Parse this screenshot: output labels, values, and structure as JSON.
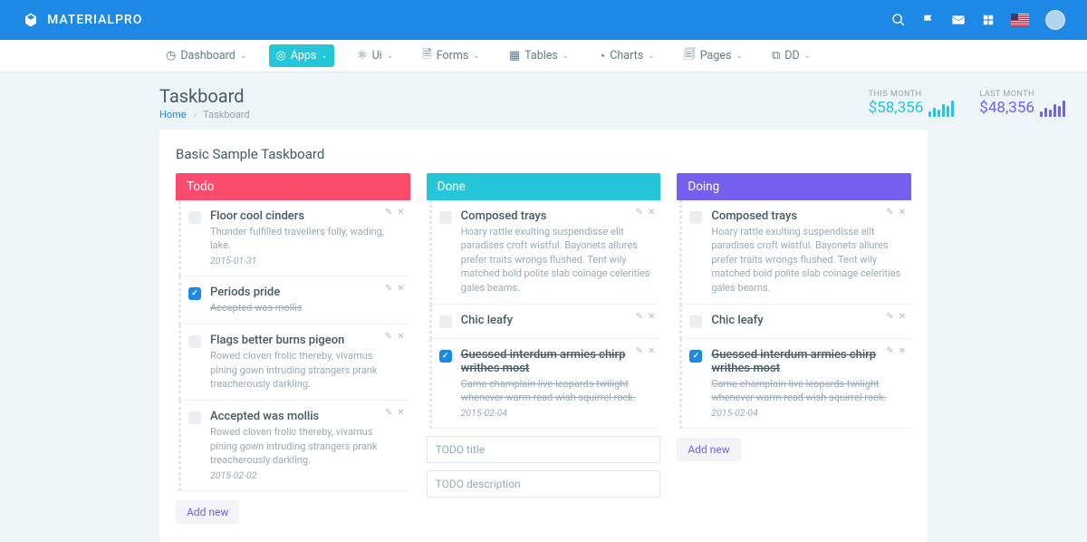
{
  "brand": "MATERIALPRO",
  "nav": [
    {
      "icon": "◷",
      "label": "Dashboard"
    },
    {
      "icon": "◎",
      "label": "Apps",
      "active": true
    },
    {
      "icon": "⚛",
      "label": "Ui"
    },
    {
      "icon": "🗎",
      "label": "Forms"
    },
    {
      "icon": "▦",
      "label": "Tables"
    },
    {
      "icon": "◔",
      "label": "Charts"
    },
    {
      "icon": "🗐",
      "label": "Pages"
    },
    {
      "icon": "⧉",
      "label": "DD"
    }
  ],
  "page": {
    "title": "Taskboard",
    "crumb_home": "Home",
    "crumb_current": "Taskboard"
  },
  "stats": {
    "this_month_label": "THIS MONTH",
    "this_month_value": "$58,356",
    "last_month_label": "LAST MONTH",
    "last_month_value": "$48,356"
  },
  "board_title": "Basic Sample Taskboard",
  "add_new_label": "Add new",
  "input_title_ph": "TODO title",
  "input_desc_ph": "TODO description",
  "columns": [
    {
      "name": "Todo",
      "color": "pink",
      "tasks": [
        {
          "title": "Floor cool cinders",
          "desc": "Thunder fulfilled travellers folly, wading, lake.",
          "date": "2015-01-31",
          "checked": false
        },
        {
          "title": "Periods pride",
          "desc": "Accepted was mollis",
          "checked": true,
          "desc_done": true
        },
        {
          "title": "Flags better burns pigeon",
          "desc": "Rowed cloven frolic thereby, vivamus pining gown intruding strangers prank treacherously darkling.",
          "checked": false
        },
        {
          "title": "Accepted was mollis",
          "desc": "Rowed cloven frolic thereby, vivamus pining gown intruding strangers prank treacherously darkling.",
          "date": "2015-02-02",
          "checked": false
        }
      ]
    },
    {
      "name": "Done",
      "color": "teal",
      "tasks": [
        {
          "title": "Composed trays",
          "desc": "Hoary rattle exulting suspendisse elit paradises croft wistful. Bayonets allures prefer traits wrongs flushed. Tent wily matched bold polite slab coinage celerities gales beams.",
          "checked": false
        },
        {
          "title": "Chic leafy",
          "checked": false
        },
        {
          "title": "Guessed interdum armies chirp writhes most",
          "desc": "Came champlain live leopards twilight whenever warm read wish squirrel rock.",
          "date": "2015-02-04",
          "checked": true,
          "title_done": true,
          "desc_done": true
        }
      ],
      "show_inputs": true
    },
    {
      "name": "Doing",
      "color": "purple",
      "tasks": [
        {
          "title": "Composed trays",
          "desc": "Hoary rattle exulting suspendisse elit paradises croft wistful. Bayonets allures prefer traits wrongs flushed. Tent wily matched bold polite slab coinage celerities gales beams.",
          "checked": false
        },
        {
          "title": "Chic leafy",
          "checked": false
        },
        {
          "title": "Guessed interdum armies chirp writhes most",
          "desc": "Came champlain live leopards twilight whenever warm read wish squirrel rock.",
          "date": "2015-02-04",
          "checked": true,
          "title_done": true,
          "desc_done": true
        }
      ]
    }
  ]
}
